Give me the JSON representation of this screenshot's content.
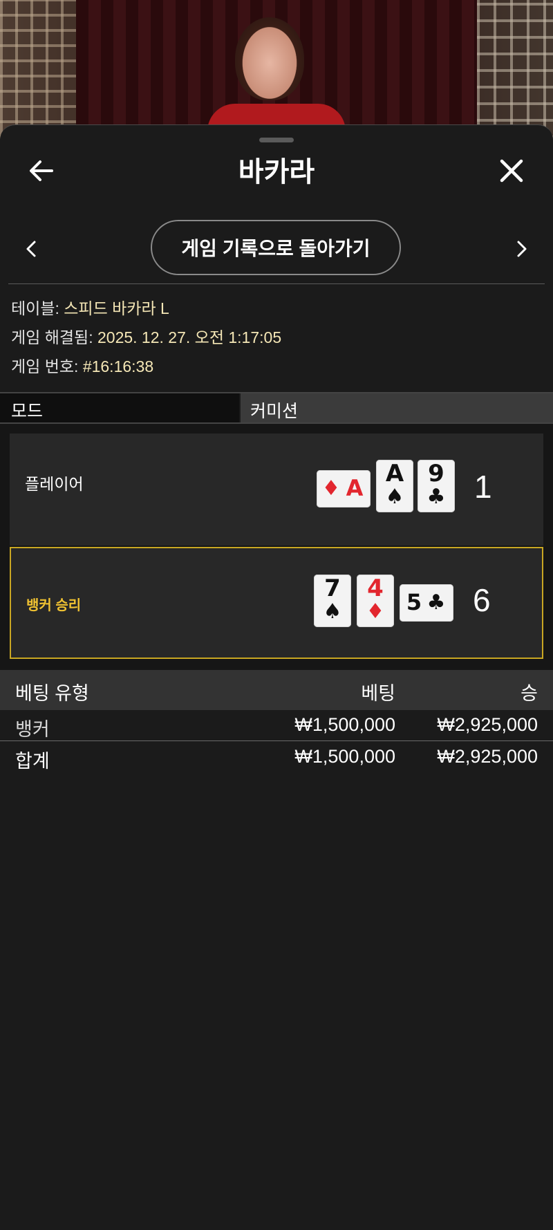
{
  "header": {
    "title": "바카라",
    "return_button": "게임 기록으로 돌아가기"
  },
  "info": {
    "table_label": "테이블:",
    "table_value": "스피드 바카라 L",
    "resolved_label": "게임 해결됨:",
    "resolved_value": "2025. 12. 27. 오전 1:17:05",
    "round_label": "게임 번호:",
    "round_value": "#16:16:38"
  },
  "modebar": {
    "mode": "모드",
    "commission": "커미션"
  },
  "hands": {
    "player": {
      "label": "플레이어",
      "score": "1",
      "cards": [
        {
          "rank": "A",
          "suit": "♦",
          "color": "#e2262e",
          "orientation": "landscape"
        },
        {
          "rank": "A",
          "suit": "♠",
          "color": "#111111",
          "orientation": "portrait"
        },
        {
          "rank": "9",
          "suit": "♣",
          "color": "#111111",
          "orientation": "portrait"
        }
      ]
    },
    "banker": {
      "label": "뱅커 승리",
      "score": "6",
      "cards": [
        {
          "rank": "7",
          "suit": "♠",
          "color": "#111111",
          "orientation": "portrait"
        },
        {
          "rank": "4",
          "suit": "♦",
          "color": "#e2262e",
          "orientation": "portrait"
        },
        {
          "rank": "5",
          "suit": "♣",
          "color": "#111111",
          "orientation": "landscape"
        }
      ]
    }
  },
  "bets": {
    "headers": {
      "type": "베팅 유형",
      "bet": "베팅",
      "win": "승"
    },
    "rows": [
      {
        "type": "뱅커",
        "bet": "₩1,500,000",
        "win": "₩2,925,000"
      }
    ],
    "total": {
      "type": "합계",
      "bet": "₩1,500,000",
      "win": "₩2,925,000"
    }
  },
  "colors": {
    "accent_gold": "#f0c232",
    "info_value": "#f5e7b6",
    "panel_bg": "#1b1b1b",
    "red_suit": "#e2262e"
  },
  "icons": {
    "back": "arrow-left-icon",
    "close": "close-icon",
    "prev": "chevron-left-icon",
    "next": "chevron-right-icon"
  }
}
